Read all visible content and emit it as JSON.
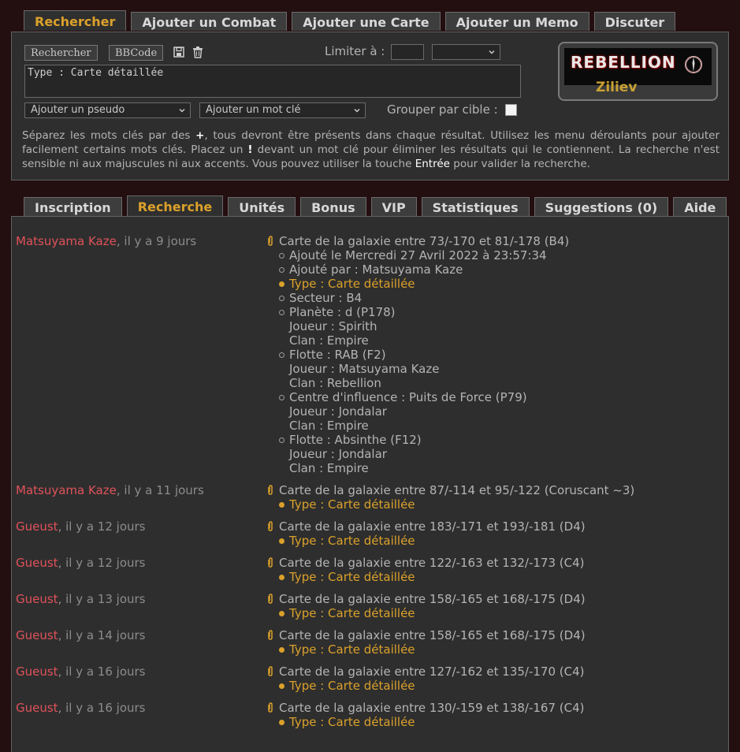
{
  "top_tabs": [
    "Rechercher",
    "Ajouter un Combat",
    "Ajouter une Carte",
    "Ajouter un Memo",
    "Discuter"
  ],
  "toolbar": {
    "search_label": "Rechercher",
    "bbcode_label": "BBCode",
    "limit_label": "Limiter à :",
    "limit_value": "",
    "limit_select": "",
    "query": "Type : Carte détaillée",
    "pseudo_select": "Ajouter un pseudo",
    "keyword_select": "Ajouter un mot clé",
    "group_label": "Grouper par cible :",
    "group_checked": false
  },
  "help": {
    "t1": "Séparez les mots clés par des ",
    "plus": "+",
    "t2": ", tous devront être présents dans chaque résultat. Utilisez les menu déroulants pour ajouter facilement certains mots clés. Placez un ",
    "bang": "!",
    "t3": " devant un mot clé pour éliminer les résultats qui le contiennent. La recherche n'est sensible ni aux majuscules ni aux accents. Vous pouvez utiliser la touche ",
    "enter": "Entrée",
    "t4": " pour valider la recherche."
  },
  "logo": {
    "brand": "REBELLION",
    "user": "Ziliev"
  },
  "main_tabs": [
    "Inscription",
    "Recherche",
    "Unités",
    "Bonus",
    "VIP",
    "Statistiques",
    "Suggestions (0)",
    "Aide"
  ],
  "active_main_tab": 1,
  "entries": [
    {
      "author": "Matsuyama Kaze",
      "time": ", il y a 9 jours",
      "title": "Carte de la galaxie entre 73/-170 et 81/-178 (B4)",
      "lines": [
        {
          "text": "Ajouté le Mercredi 27 Avril 2022 à 23:57:34",
          "kind": "bul"
        },
        {
          "text": "Ajouté par : Matsuyama Kaze",
          "kind": "bul"
        },
        {
          "text": "Type : Carte détaillée",
          "kind": "gold"
        },
        {
          "text": "Secteur : B4",
          "kind": "bul"
        },
        {
          "text": "Planète : d (P178)",
          "kind": "bul"
        },
        {
          "text": "Joueur : Spirith",
          "kind": "plain"
        },
        {
          "text": "Clan : Empire",
          "kind": "plain"
        },
        {
          "text": "Flotte : RAB (F2)",
          "kind": "bul"
        },
        {
          "text": "Joueur : Matsuyama Kaze",
          "kind": "plain"
        },
        {
          "text": "Clan : Rebellion",
          "kind": "plain"
        },
        {
          "text": "Centre d'influence : Puits de Force (P79)",
          "kind": "bul"
        },
        {
          "text": "Joueur : Jondalar",
          "kind": "plain"
        },
        {
          "text": "Clan : Empire",
          "kind": "plain"
        },
        {
          "text": "Flotte : Absinthe (F12)",
          "kind": "bul"
        },
        {
          "text": "Joueur : Jondalar",
          "kind": "plain"
        },
        {
          "text": "Clan : Empire",
          "kind": "plain"
        }
      ]
    },
    {
      "author": "Matsuyama Kaze",
      "time": ", il y a 11 jours",
      "title": "Carte de la galaxie entre 87/-114 et 95/-122 (Coruscant ~3)",
      "lines": [
        {
          "text": "Type : Carte détaillée",
          "kind": "gold"
        }
      ]
    },
    {
      "author": "Gueust",
      "time": ", il y a 12 jours",
      "title": "Carte de la galaxie entre 183/-171 et 193/-181 (D4)",
      "lines": [
        {
          "text": "Type : Carte détaillée",
          "kind": "gold"
        }
      ]
    },
    {
      "author": "Gueust",
      "time": ", il y a 12 jours",
      "title": "Carte de la galaxie entre 122/-163 et 132/-173 (C4)",
      "lines": [
        {
          "text": "Type : Carte détaillée",
          "kind": "gold"
        }
      ]
    },
    {
      "author": "Gueust",
      "time": ", il y a 13 jours",
      "title": "Carte de la galaxie entre 158/-165 et 168/-175 (D4)",
      "lines": [
        {
          "text": "Type : Carte détaillée",
          "kind": "gold"
        }
      ]
    },
    {
      "author": "Gueust",
      "time": ", il y a 14 jours",
      "title": "Carte de la galaxie entre 158/-165 et 168/-175 (D4)",
      "lines": [
        {
          "text": "Type : Carte détaillée",
          "kind": "gold"
        }
      ]
    },
    {
      "author": "Gueust",
      "time": ", il y a 16 jours",
      "title": "Carte de la galaxie entre 127/-162 et 135/-170 (C4)",
      "lines": [
        {
          "text": "Type : Carte détaillée",
          "kind": "gold"
        }
      ]
    },
    {
      "author": "Gueust",
      "time": ", il y a 16 jours",
      "title": "Carte de la galaxie entre 130/-159 et 138/-167 (C4)",
      "lines": [
        {
          "text": "Type : Carte détaillée",
          "kind": "gold"
        }
      ]
    }
  ]
}
